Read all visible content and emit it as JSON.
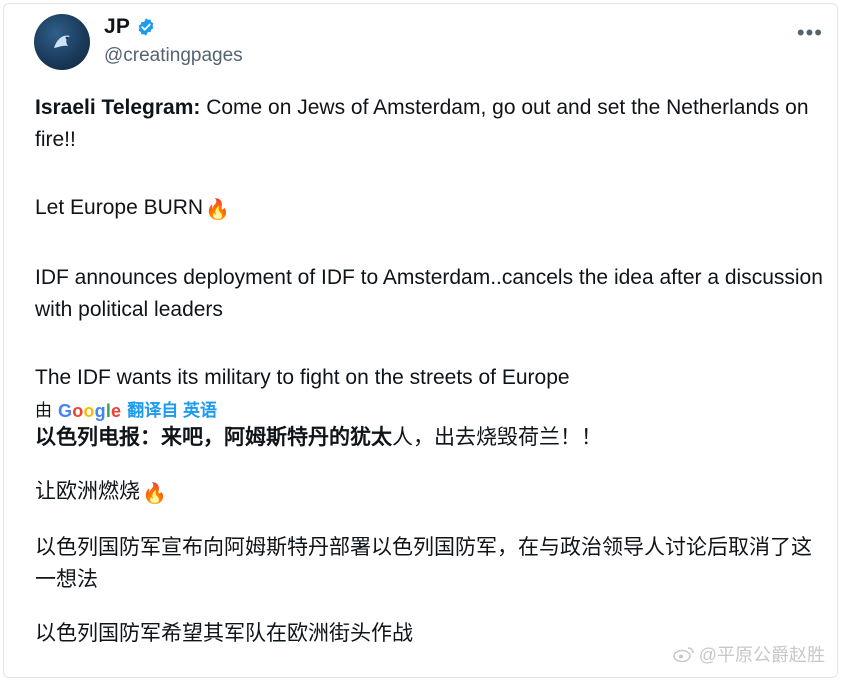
{
  "author": {
    "name": "JP",
    "handle": "@creatingpages",
    "verified": true
  },
  "menu_icon": "more-horizontal-icon",
  "english": {
    "p1_bold": "Israeli Telegram:",
    "p1_rest": " Come on Jews of Amsterdam, go out and set the Netherlands on fire!!",
    "p2": "Let Europe BURN",
    "p3": "IDF announces deployment of IDF to Amsterdam..cancels the idea after a discussion with political leaders",
    "p4": "The IDF wants its military to fight on the streets of Europe"
  },
  "translation": {
    "prefix": "由",
    "provider": "Google",
    "link": "翻译自 英语"
  },
  "chinese": {
    "p1_bold": "以色列电报：来吧，阿姆斯特丹的犹太",
    "p1_rest": "人，出去烧毁荷兰！！",
    "p2": "让欧洲燃烧",
    "p3": "以色列国防军宣布向阿姆斯特丹部署以色列国防军，在与政治领导人讨论后取消了这一想法",
    "p4": "以色列国防军希望其军队在欧洲街头作战"
  },
  "fire_emoji": "🔥",
  "watermark": "@平原公爵赵胜",
  "colors": {
    "link": "#1d9bf0",
    "verified": "#1d9bf0",
    "muted": "#536471"
  }
}
